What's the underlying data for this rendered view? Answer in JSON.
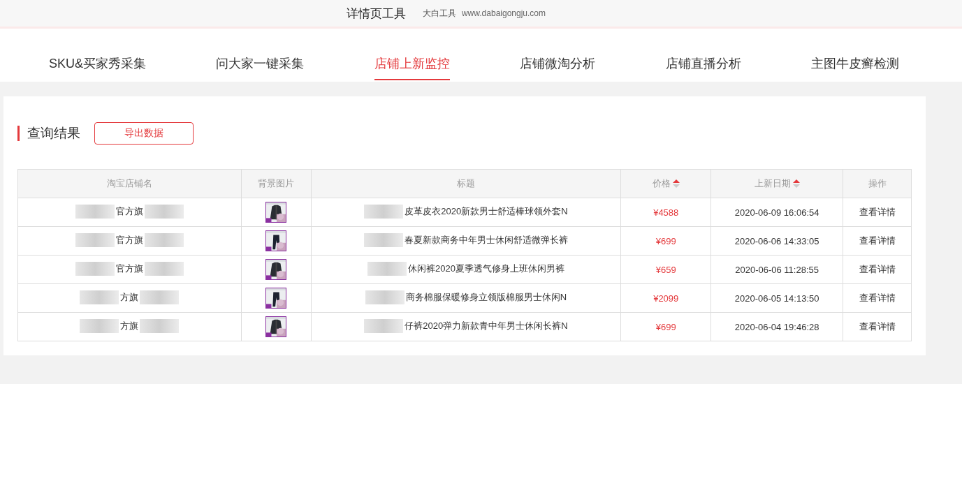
{
  "header": {
    "title": "详情页工具",
    "brand": "大白工具",
    "url": "www.dabaigongju.com"
  },
  "tabs": [
    {
      "label": "SKU&买家秀采集",
      "selected": false
    },
    {
      "label": "问大家一键采集",
      "selected": false
    },
    {
      "label": "店铺上新监控",
      "selected": true
    },
    {
      "label": "店铺微淘分析",
      "selected": false
    },
    {
      "label": "店铺直播分析",
      "selected": false
    },
    {
      "label": "主图牛皮癣检测",
      "selected": false
    }
  ],
  "results": {
    "heading": "查询结果",
    "export_button": "导出数据"
  },
  "table": {
    "columns": [
      {
        "label": "淘宝店铺名",
        "sortable": false
      },
      {
        "label": "背景图片",
        "sortable": false
      },
      {
        "label": "标题",
        "sortable": false
      },
      {
        "label": "价格",
        "sortable": true
      },
      {
        "label": "上新日期",
        "sortable": true
      },
      {
        "label": "操作",
        "sortable": false
      }
    ],
    "rows": [
      {
        "shop": "官方旗",
        "title": "皮革皮衣2020新款男士舒适棒球领外套N",
        "price": "¥4588",
        "date": "2020-06-09 16:06:54",
        "action": "查看详情"
      },
      {
        "shop": "官方旗",
        "title": "春夏新款商务中年男士休闲舒适微弹长裤",
        "price": "¥699",
        "date": "2020-06-06 14:33:05",
        "action": "查看详情"
      },
      {
        "shop": "官方旗",
        "title": "休闲裤2020夏季透气修身上班休闲男裤",
        "price": "¥659",
        "date": "2020-06-06 11:28:55",
        "action": "查看详情"
      },
      {
        "shop": "方旗",
        "title": "商务棉服保暖修身立领版棉服男士休闲N",
        "price": "¥2099",
        "date": "2020-06-05 14:13:50",
        "action": "查看详情"
      },
      {
        "shop": "方旗",
        "title": "仔裤2020弹力新款青中年男士休闲长裤N",
        "price": "¥699",
        "date": "2020-06-04 19:46:28",
        "action": "查看详情"
      }
    ]
  }
}
